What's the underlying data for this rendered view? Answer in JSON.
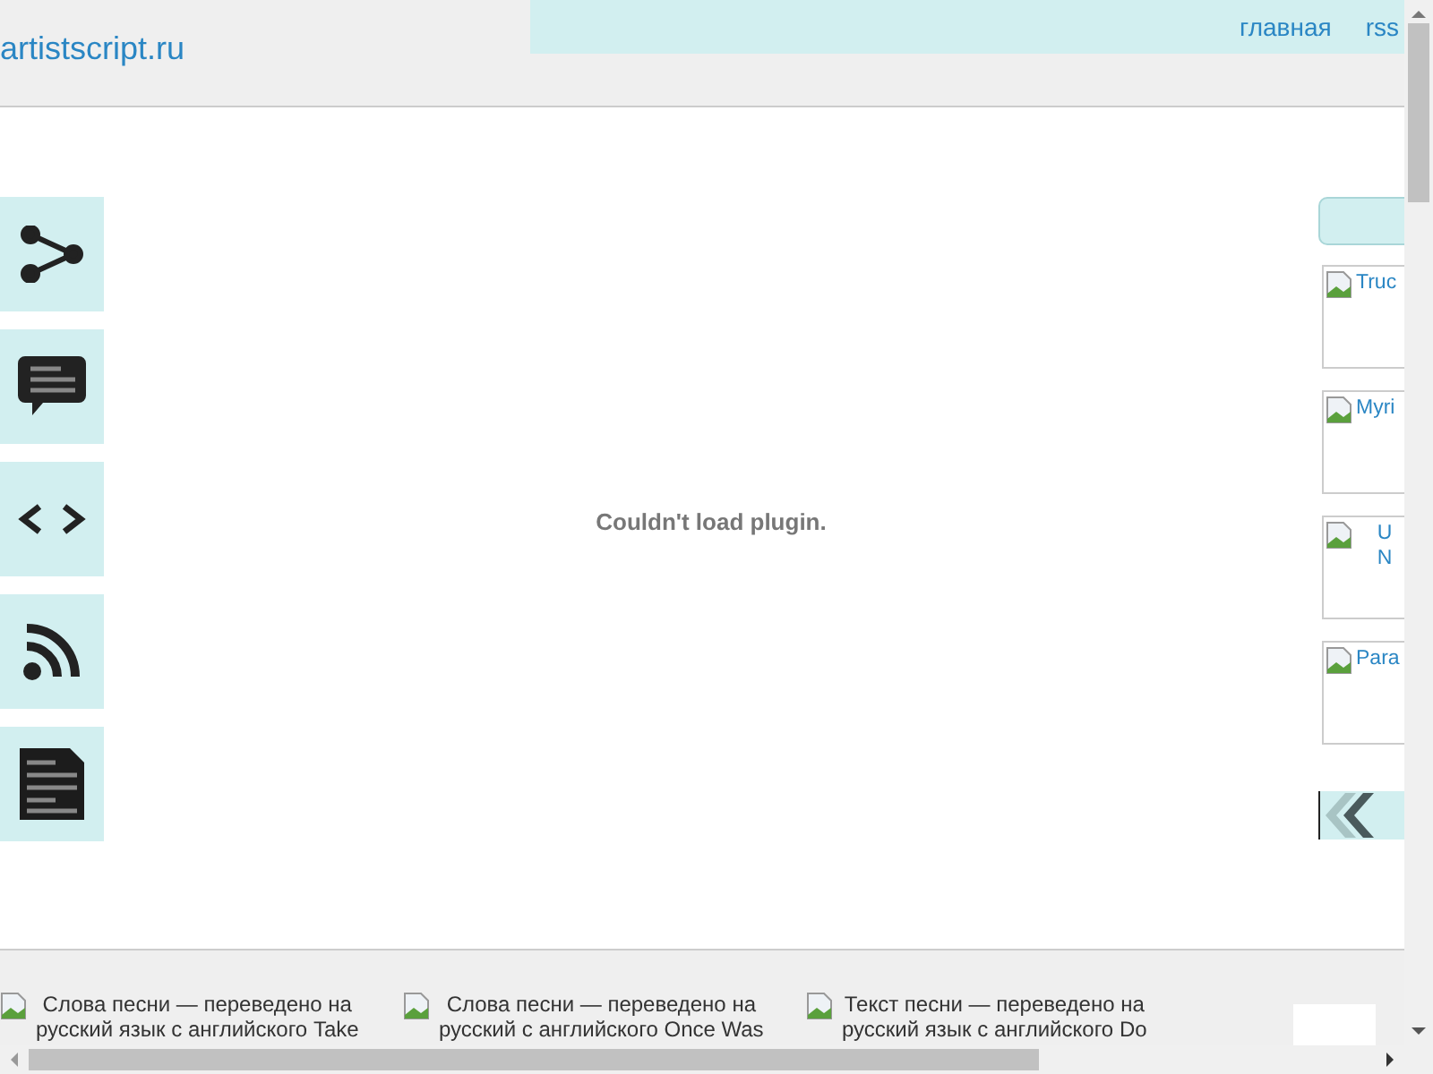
{
  "header": {
    "site_title": "artistscript.ru",
    "nav": [
      "главная",
      "rss"
    ]
  },
  "share_buttons": [
    {
      "kind": "share"
    },
    {
      "kind": "comment"
    },
    {
      "kind": "embed"
    },
    {
      "kind": "rss"
    },
    {
      "kind": "document"
    }
  ],
  "plugin_message": "Couldn't load plugin.",
  "side_links": [
    {
      "text": "Truc",
      "kind": "inline"
    },
    {
      "text": "Myri",
      "kind": "inline"
    },
    {
      "text": "U N",
      "kind": "wrapped"
    },
    {
      "text": "Para",
      "kind": "inline"
    }
  ],
  "related": [
    {
      "lines": [
        "Слова песни — переведено на",
        "русский язык с английского Take"
      ]
    },
    {
      "lines": [
        "Слова песни — переведено на",
        "русский с английского Once Was"
      ]
    },
    {
      "lines": [
        "Текст песни — переведено на",
        "русский язык с английского Do"
      ]
    }
  ]
}
